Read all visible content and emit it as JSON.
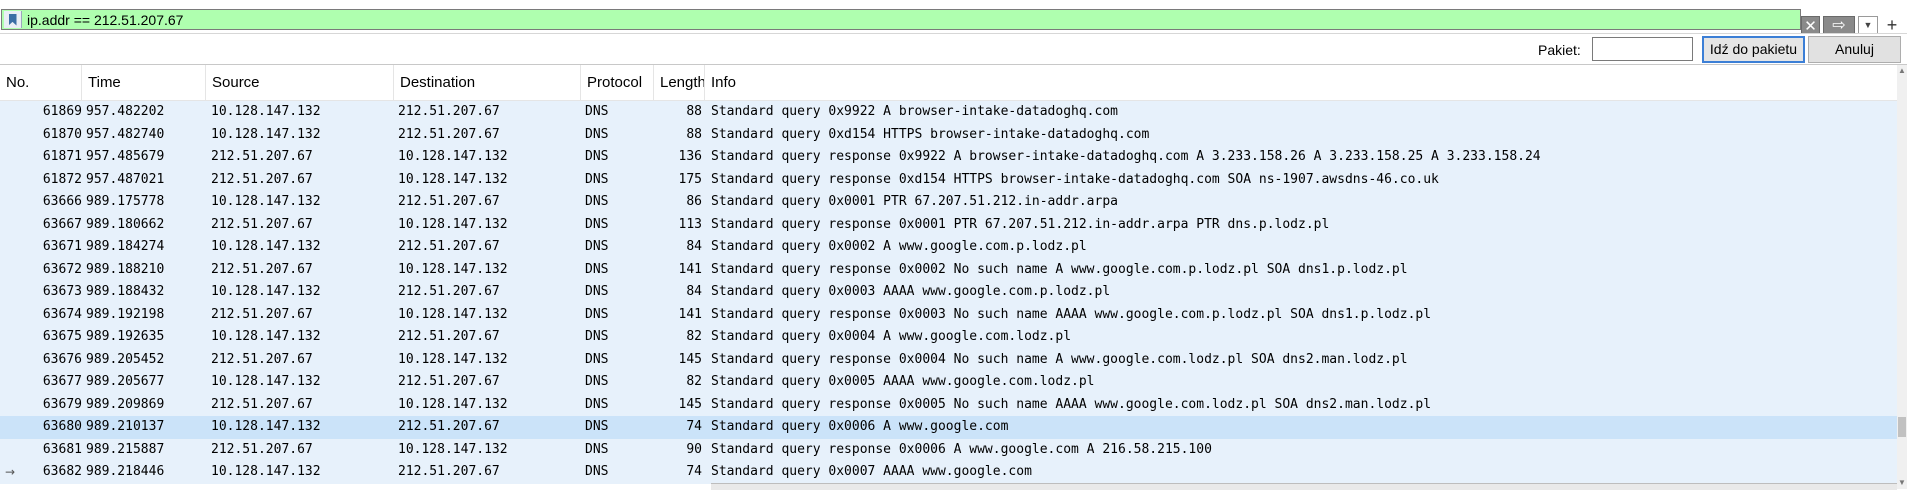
{
  "filter": {
    "value": "ip.addr == 212.51.207.67",
    "bookmark_icon": "bookmark-icon",
    "clear_icon": "✕",
    "apply_icon": "⇨",
    "dropdown_icon": "▼",
    "plus_icon": "+",
    "bg_color": "#afffaf"
  },
  "goto": {
    "label": "Pakiet:",
    "input_value": "",
    "go_button": "Idź do pakietu",
    "cancel_button": "Anuluj"
  },
  "columns": [
    "No.",
    "Time",
    "Source",
    "Destination",
    "Protocol",
    "Length",
    "Info"
  ],
  "rows": [
    {
      "no": "61869",
      "time": "957.482202",
      "src": "10.128.147.132",
      "dst": "212.51.207.67",
      "proto": "DNS",
      "len": "88",
      "info": "Standard query 0x9922 A browser-intake-datadoghq.com"
    },
    {
      "no": "61870",
      "time": "957.482740",
      "src": "10.128.147.132",
      "dst": "212.51.207.67",
      "proto": "DNS",
      "len": "88",
      "info": "Standard query 0xd154 HTTPS browser-intake-datadoghq.com"
    },
    {
      "no": "61871",
      "time": "957.485679",
      "src": "212.51.207.67",
      "dst": "10.128.147.132",
      "proto": "DNS",
      "len": "136",
      "info": "Standard query response 0x9922 A browser-intake-datadoghq.com A 3.233.158.26 A 3.233.158.25 A 3.233.158.24"
    },
    {
      "no": "61872",
      "time": "957.487021",
      "src": "212.51.207.67",
      "dst": "10.128.147.132",
      "proto": "DNS",
      "len": "175",
      "info": "Standard query response 0xd154 HTTPS browser-intake-datadoghq.com SOA ns-1907.awsdns-46.co.uk"
    },
    {
      "no": "63666",
      "time": "989.175778",
      "src": "10.128.147.132",
      "dst": "212.51.207.67",
      "proto": "DNS",
      "len": "86",
      "info": "Standard query 0x0001 PTR 67.207.51.212.in-addr.arpa"
    },
    {
      "no": "63667",
      "time": "989.180662",
      "src": "212.51.207.67",
      "dst": "10.128.147.132",
      "proto": "DNS",
      "len": "113",
      "info": "Standard query response 0x0001 PTR 67.207.51.212.in-addr.arpa PTR dns.p.lodz.pl"
    },
    {
      "no": "63671",
      "time": "989.184274",
      "src": "10.128.147.132",
      "dst": "212.51.207.67",
      "proto": "DNS",
      "len": "84",
      "info": "Standard query 0x0002 A www.google.com.p.lodz.pl"
    },
    {
      "no": "63672",
      "time": "989.188210",
      "src": "212.51.207.67",
      "dst": "10.128.147.132",
      "proto": "DNS",
      "len": "141",
      "info": "Standard query response 0x0002 No such name A www.google.com.p.lodz.pl SOA dns1.p.lodz.pl"
    },
    {
      "no": "63673",
      "time": "989.188432",
      "src": "10.128.147.132",
      "dst": "212.51.207.67",
      "proto": "DNS",
      "len": "84",
      "info": "Standard query 0x0003 AAAA www.google.com.p.lodz.pl"
    },
    {
      "no": "63674",
      "time": "989.192198",
      "src": "212.51.207.67",
      "dst": "10.128.147.132",
      "proto": "DNS",
      "len": "141",
      "info": "Standard query response 0x0003 No such name AAAA www.google.com.p.lodz.pl SOA dns1.p.lodz.pl"
    },
    {
      "no": "63675",
      "time": "989.192635",
      "src": "10.128.147.132",
      "dst": "212.51.207.67",
      "proto": "DNS",
      "len": "82",
      "info": "Standard query 0x0004 A www.google.com.lodz.pl"
    },
    {
      "no": "63676",
      "time": "989.205452",
      "src": "212.51.207.67",
      "dst": "10.128.147.132",
      "proto": "DNS",
      "len": "145",
      "info": "Standard query response 0x0004 No such name A www.google.com.lodz.pl SOA dns2.man.lodz.pl"
    },
    {
      "no": "63677",
      "time": "989.205677",
      "src": "10.128.147.132",
      "dst": "212.51.207.67",
      "proto": "DNS",
      "len": "82",
      "info": "Standard query 0x0005 AAAA www.google.com.lodz.pl"
    },
    {
      "no": "63679",
      "time": "989.209869",
      "src": "212.51.207.67",
      "dst": "10.128.147.132",
      "proto": "DNS",
      "len": "145",
      "info": "Standard query response 0x0005 No such name AAAA www.google.com.lodz.pl SOA dns2.man.lodz.pl"
    },
    {
      "no": "63680",
      "time": "989.210137",
      "src": "10.128.147.132",
      "dst": "212.51.207.67",
      "proto": "DNS",
      "len": "74",
      "info": "Standard query 0x0006 A www.google.com"
    },
    {
      "no": "63681",
      "time": "989.215887",
      "src": "212.51.207.67",
      "dst": "10.128.147.132",
      "proto": "DNS",
      "len": "90",
      "info": "Standard query response 0x0006 A www.google.com A 216.58.215.100"
    },
    {
      "no": "63682",
      "time": "989.218446",
      "src": "10.128.147.132",
      "dst": "212.51.207.67",
      "proto": "DNS",
      "len": "74",
      "info": "Standard query 0x0007 AAAA www.google.com"
    }
  ],
  "selected_row": "63680",
  "row_color": "#e7f1fb",
  "selected_row_color": "#cbe3f9"
}
